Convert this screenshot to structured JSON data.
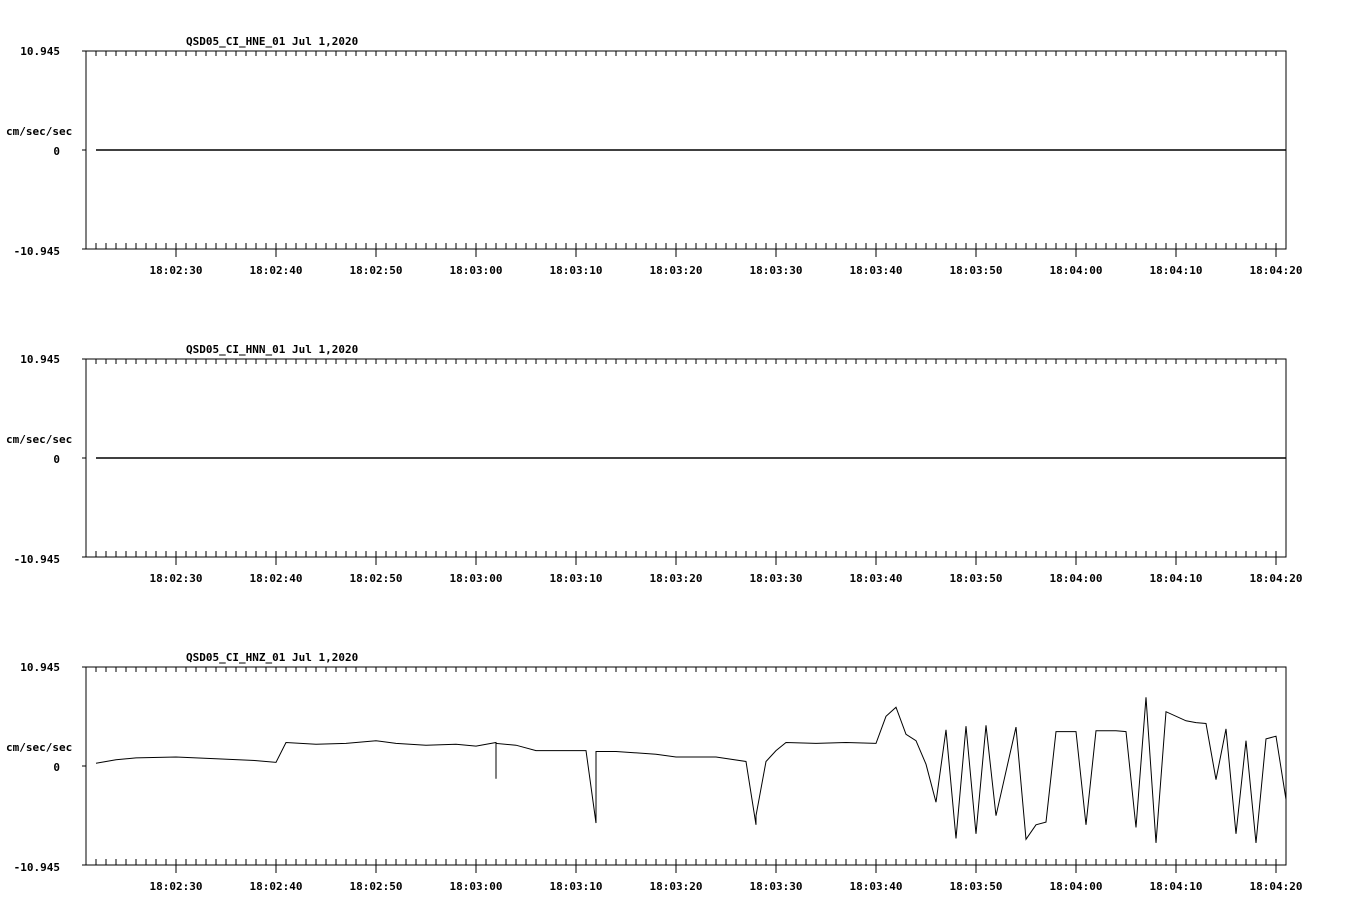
{
  "page": {
    "background": "#ffffff",
    "ink": "#000000"
  },
  "chart_data": [
    {
      "type": "line",
      "title": "QSD05_CI_HNE_01  Jul 1,2020",
      "ylabel": "cm/sec/sec",
      "ylim": [
        -10.945,
        10.945
      ],
      "yticks": [
        "10.945",
        "0",
        "-10.945"
      ],
      "xlim": [
        "18:02:21",
        "18:04:21"
      ],
      "xticks": [
        "18:02:30",
        "18:02:40",
        "18:02:50",
        "18:03:00",
        "18:03:10",
        "18:03:20",
        "18:03:30",
        "18:03:40",
        "18:03:50",
        "18:04:00",
        "18:04:10",
        "18:04:20"
      ],
      "grid": false,
      "series": [
        {
          "color": "#000000",
          "x": [
            "18:02:22",
            "18:04:21"
          ],
          "y": [
            0,
            0
          ]
        }
      ]
    },
    {
      "type": "line",
      "title": "QSD05_CI_HNN_01  Jul 1,2020",
      "ylabel": "cm/sec/sec",
      "ylim": [
        -10.945,
        10.945
      ],
      "yticks": [
        "10.945",
        "0",
        "-10.945"
      ],
      "xlim": [
        "18:02:21",
        "18:04:21"
      ],
      "xticks": [
        "18:02:30",
        "18:02:40",
        "18:02:50",
        "18:03:00",
        "18:03:10",
        "18:03:20",
        "18:03:30",
        "18:03:40",
        "18:03:50",
        "18:04:00",
        "18:04:10",
        "18:04:20"
      ],
      "grid": false,
      "series": [
        {
          "color": "#000000",
          "x": [
            "18:02:22",
            "18:04:21"
          ],
          "y": [
            0,
            0
          ]
        }
      ]
    },
    {
      "type": "line",
      "title": "QSD05_CI_HNZ_01  Jul 1,2020",
      "ylabel": "cm/sec/sec",
      "ylim": [
        -10.945,
        10.945
      ],
      "yticks": [
        "10.945",
        "0",
        "-10.945"
      ],
      "xlim": [
        "18:02:21",
        "18:04:21"
      ],
      "xticks": [
        "18:02:30",
        "18:02:40",
        "18:02:50",
        "18:03:00",
        "18:03:10",
        "18:03:20",
        "18:03:30",
        "18:03:40",
        "18:03:50",
        "18:04:00",
        "18:04:10",
        "18:04:20"
      ],
      "grid": false,
      "series": [
        {
          "color": "#000000",
          "x": [
            "18:02:22",
            "18:02:24",
            "18:02:26",
            "18:02:30",
            "18:02:34",
            "18:02:38",
            "18:02:40",
            "18:02:41",
            "18:02:44",
            "18:02:47",
            "18:02:50",
            "18:02:52",
            "18:02:55",
            "18:02:58",
            "18:03:00",
            "18:03:02",
            "18:03:02",
            "18:03:02",
            "18:03:04",
            "18:03:06",
            "18:03:08",
            "18:03:11",
            "18:03:12",
            "18:03:12",
            "18:03:12",
            "18:03:14",
            "18:03:18",
            "18:03:20",
            "18:03:24",
            "18:03:27",
            "18:03:28",
            "18:03:28",
            "18:03:29",
            "18:03:30",
            "18:03:31",
            "18:03:34",
            "18:03:37",
            "18:03:40",
            "18:03:41",
            "18:03:42",
            "18:03:43",
            "18:03:44",
            "18:03:45",
            "18:03:46",
            "18:03:47",
            "18:03:48",
            "18:03:49",
            "18:03:50",
            "18:03:51",
            "18:03:52",
            "18:03:54",
            "18:03:55",
            "18:03:56",
            "18:03:57",
            "18:03:58",
            "18:04:00",
            "18:04:01",
            "18:04:02",
            "18:04:04",
            "18:04:05",
            "18:04:06",
            "18:04:07",
            "18:04:08",
            "18:04:09",
            "18:04:11",
            "18:04:12",
            "18:04:13",
            "18:04:14",
            "18:04:15",
            "18:04:16",
            "18:04:17",
            "18:04:18",
            "18:04:19",
            "18:04:20",
            "18:04:21"
          ],
          "y": [
            0.3,
            0.7,
            0.9,
            1.0,
            0.8,
            0.6,
            0.4,
            2.6,
            2.4,
            2.5,
            2.8,
            2.5,
            2.3,
            2.4,
            2.2,
            2.6,
            -1.4,
            2.5,
            2.3,
            1.7,
            1.7,
            1.7,
            -6.3,
            1.0,
            1.6,
            1.6,
            1.3,
            1.0,
            1.0,
            0.5,
            -6.5,
            -5.5,
            0.5,
            1.7,
            2.6,
            2.5,
            2.6,
            2.5,
            5.5,
            6.5,
            3.5,
            2.8,
            0.2,
            -4.0,
            4.0,
            -8.0,
            4.4,
            -7.5,
            4.5,
            -5.5,
            4.3,
            -8.1,
            -6.5,
            -6.2,
            3.8,
            3.8,
            -6.5,
            3.9,
            3.9,
            3.8,
            -6.8,
            7.6,
            -8.5,
            6.0,
            5.0,
            4.8,
            4.7,
            -1.5,
            4.1,
            -7.5,
            2.8,
            -8.5,
            3.0,
            3.3,
            -3.7
          ]
        }
      ]
    }
  ]
}
